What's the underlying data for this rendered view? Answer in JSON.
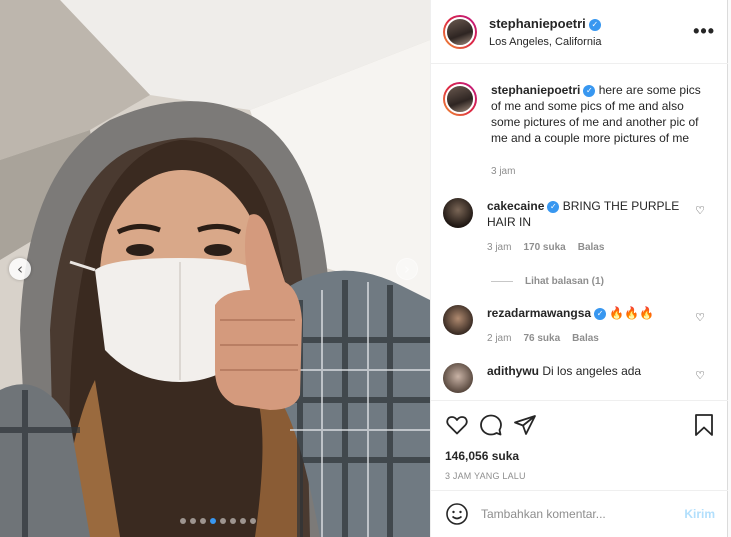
{
  "post": {
    "username": "stephaniepoetri",
    "location": "Los Angeles, California",
    "caption": "here are some pics of me and some pics of me and also some pictures of me and another pic of me and a couple more pictures of me",
    "caption_time": "3 jam",
    "likes": "146,056 suka",
    "time_ago": "3 JAM YANG LALU",
    "verified": true
  },
  "carousel": {
    "total_slides": 8,
    "active_index": 3
  },
  "comments": [
    {
      "username": "cakecaine",
      "verified": true,
      "text": "BRING THE PURPLE HAIR IN",
      "time": "3 jam",
      "likes": "170 suka",
      "reply_label": "Balas",
      "view_replies": "Lihat balasan (1)"
    },
    {
      "username": "rezadarmawangsa",
      "verified": true,
      "text": "🔥🔥🔥",
      "time": "2 jam",
      "likes": "76 suka",
      "reply_label": "Balas"
    },
    {
      "username": "adithywu",
      "verified": false,
      "text": "Di los angeles ada"
    }
  ],
  "composer": {
    "placeholder": "Tambahkan komentar...",
    "post_label": "Kirim"
  },
  "icons": {
    "more": "more-options-icon",
    "like": "heart-icon",
    "comment": "comment-icon",
    "share": "share-icon",
    "save": "bookmark-icon",
    "emoji": "emoji-icon"
  },
  "colors": {
    "accent": "#3897f0",
    "disabled_post": "#b2dffc",
    "secondary_text": "#8e8e8e"
  }
}
